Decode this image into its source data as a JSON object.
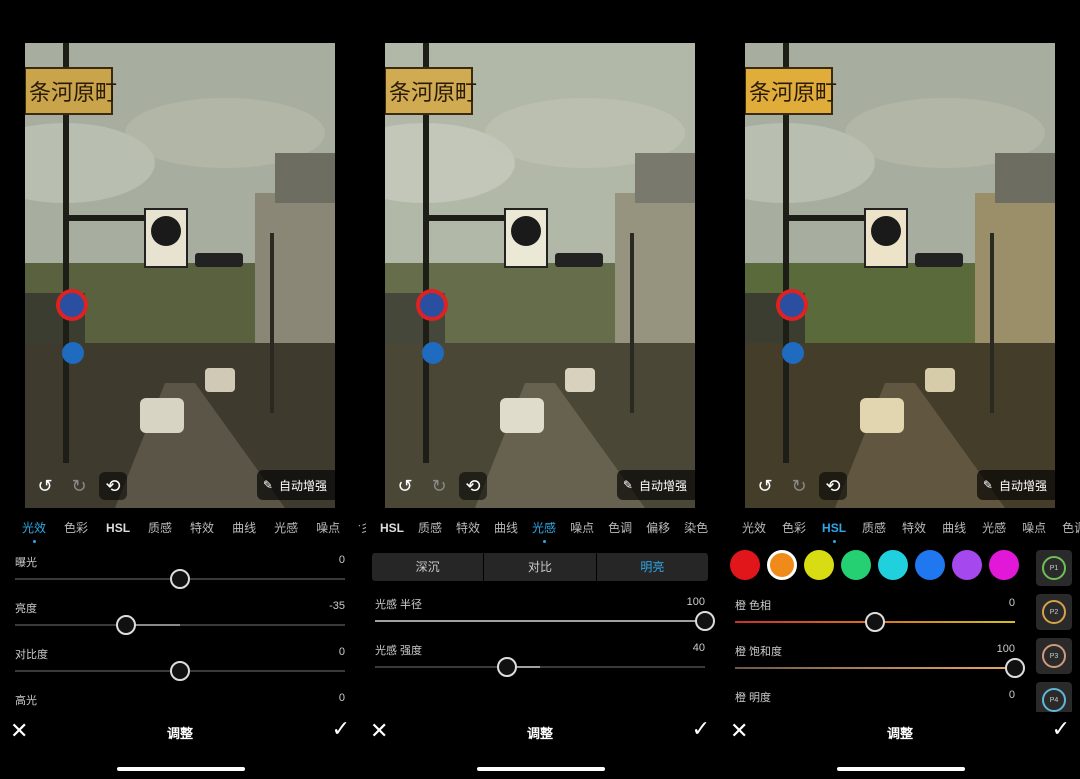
{
  "photo": {
    "sign_text": "条河原町",
    "tools": {
      "undo_icon": "undo-icon",
      "redo_icon": "redo-icon",
      "reset_icon": "reset-icon"
    },
    "auto_enhance_label": "自动增强",
    "auto_enhance_icon": "magic-wand-icon"
  },
  "panels": [
    {
      "tabs": [
        "光效",
        "色彩",
        "HSL",
        "质感",
        "特效",
        "曲线",
        "光感",
        "噪点",
        "色调",
        "彡"
      ],
      "active_tab": 0,
      "sliders": [
        {
          "label": "曝光",
          "value": "0",
          "knob": 0.5
        },
        {
          "label": "亮度",
          "value": "-35",
          "knob": 0.335
        },
        {
          "label": "对比度",
          "value": "0",
          "knob": 0.5
        },
        {
          "label": "高光",
          "value": "0"
        }
      ],
      "title": "调整"
    },
    {
      "tabs": [
        "彡",
        "HSL",
        "质感",
        "特效",
        "曲线",
        "光感",
        "噪点",
        "色调",
        "偏移",
        "染色"
      ],
      "active_tab": 5,
      "segments": [
        "深沉",
        "对比",
        "明亮"
      ],
      "active_segment": 2,
      "sliders": [
        {
          "label": "光感 半径",
          "value": "100",
          "knob": 1.0
        },
        {
          "label": "光感 强度",
          "value": "40",
          "knob": 0.4
        }
      ],
      "title": "调整"
    },
    {
      "tabs": [
        "光效",
        "色彩",
        "HSL",
        "质感",
        "特效",
        "曲线",
        "光感",
        "噪点",
        "色调"
      ],
      "active_tab": 2,
      "swatches": [
        "#e0161b",
        "#f08a1a",
        "#d8dc12",
        "#25d073",
        "#20d0dc",
        "#1f78ef",
        "#a548ee",
        "#e218d8"
      ],
      "selected_swatch": 1,
      "presets": [
        {
          "label": "P1",
          "color": "#6fbf58"
        },
        {
          "label": "P2",
          "color": "#d8a14a"
        },
        {
          "label": "P3",
          "color": "#cf9a7e"
        },
        {
          "label": "P4",
          "color": "#5fb8d8"
        }
      ],
      "sliders": [
        {
          "label": "橙 色相",
          "value": "0",
          "knob": 0.5
        },
        {
          "label": "橙 饱和度",
          "value": "100",
          "knob": 1.0
        },
        {
          "label": "橙 明度",
          "value": "0"
        }
      ],
      "title": "调整"
    }
  ],
  "colors": {
    "accent": "#2ea8e6",
    "background": "#000000"
  }
}
